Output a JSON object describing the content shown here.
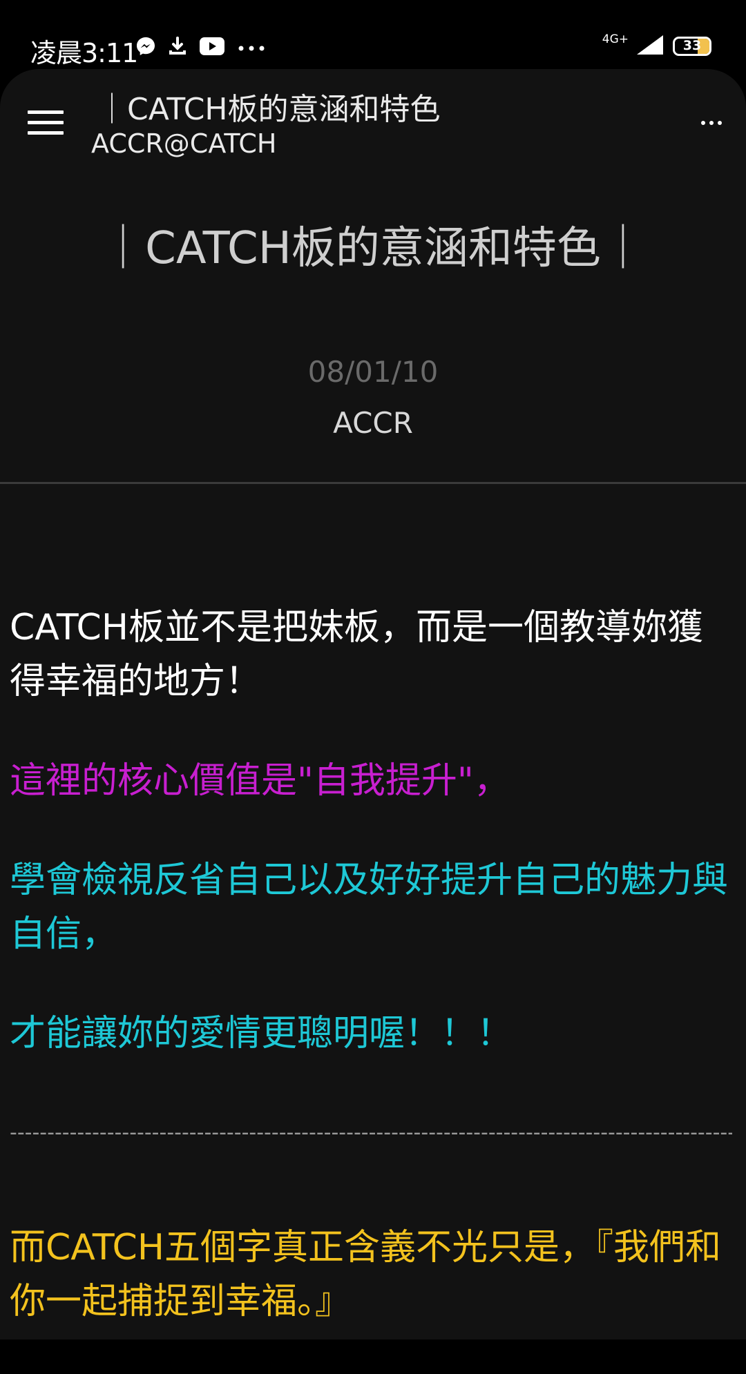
{
  "status_bar": {
    "time": "凌晨3:11",
    "network": "4G+",
    "battery": "33",
    "icons": [
      "messenger-icon",
      "download-icon",
      "youtube-icon",
      "more-dots-icon",
      "signal-icon",
      "battery-icon"
    ]
  },
  "toolbar": {
    "title": "｜CATCH板的意涵和特色",
    "subtitle": "ACCR@CATCH",
    "menu_icon": "hamburger-menu-icon",
    "more_icon": "more-options-icon"
  },
  "article": {
    "title": "｜CATCH板的意涵和特色｜",
    "date": "08/01/10",
    "author": "ACCR"
  },
  "content": {
    "colors": {
      "white": "#ffffff",
      "purple": "#c81fd0",
      "cyan": "#1ec8d6",
      "gold": "#f3c21e",
      "divider": "#9a9a9a"
    },
    "paragraphs": [
      "CATCH板並不是把妹板，而是一個教導妳獲得幸福的地方！",
      "這裡的核心價值是\"自我提升\"，",
      "學會檢視反省自己以及好好提升自己的魅力與自信，",
      "才能讓妳的愛情更聰明喔！！！",
      "--------------------------------------------------------------------------------------------------",
      "而CATCH五個字真正含義不光只是，『我們和你一起捕捉到幸福。』"
    ]
  }
}
